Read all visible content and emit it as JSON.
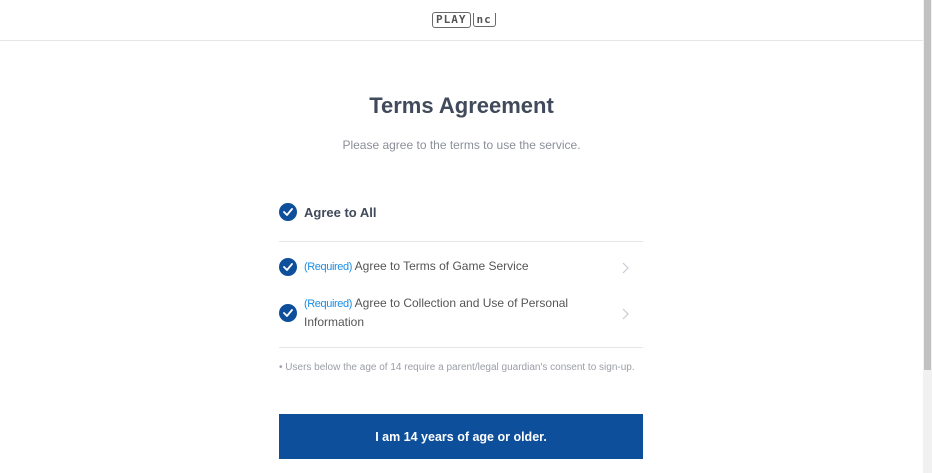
{
  "header": {
    "logo_play": "PLAY",
    "logo_nc": "nc"
  },
  "main": {
    "title": "Terms Agreement",
    "subtitle": "Please agree to the terms to use the service.",
    "agree_all_label": "Agree to All",
    "terms": [
      {
        "required_tag": "(Required)",
        "label": "Agree to Terms of Game Service"
      },
      {
        "required_tag": "(Required)",
        "label": "Agree to Collection and Use of Personal Information"
      }
    ],
    "notice": "• Users below the age of 14 require a parent/legal guardian's consent to sign-up.",
    "age_button_label": "I am 14 years of age or older."
  },
  "colors": {
    "accent": "#0e4f9b",
    "required": "#1b8ee6",
    "title": "#404a5a"
  }
}
